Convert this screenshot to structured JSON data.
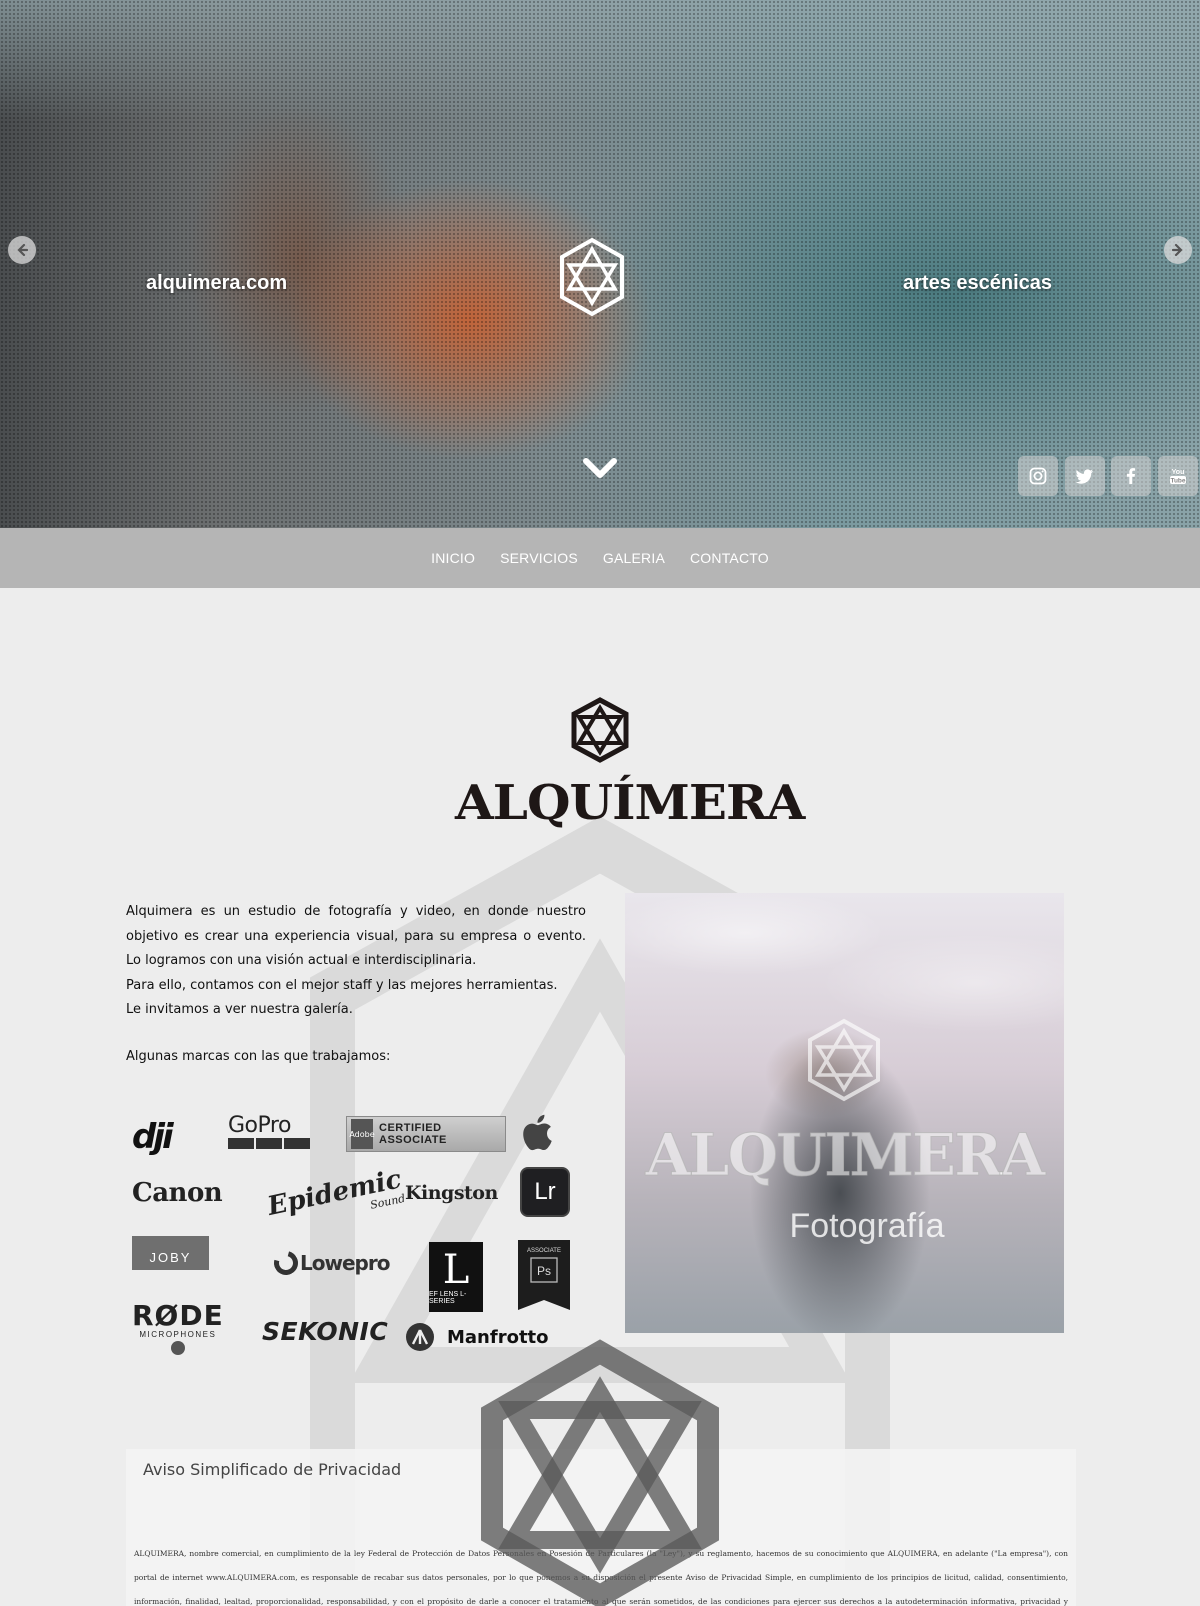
{
  "hero": {
    "left_text": "alquimera.com",
    "right_text": "artes escénicas",
    "prev_icon": "arrow-left-icon",
    "next_icon": "arrow-right-icon",
    "scroll_icon": "chevron-down-icon",
    "social": [
      {
        "name": "instagram",
        "icon": "instagram-icon"
      },
      {
        "name": "twitter",
        "icon": "twitter-icon"
      },
      {
        "name": "facebook",
        "icon": "facebook-icon"
      },
      {
        "name": "youtube",
        "icon": "youtube-icon",
        "label": "You Tube"
      }
    ]
  },
  "nav": {
    "items": [
      {
        "label": "INICIO"
      },
      {
        "label": "SERVICIOS"
      },
      {
        "label": "GALERIA"
      },
      {
        "label": "CONTACTO"
      }
    ]
  },
  "brand": {
    "wordmark": "ALQUÍMERA",
    "logo_icon": "alquimera-emblem-icon"
  },
  "intro": {
    "paragraph1": "Alquimera es un estudio de fotografía y video, en donde nuestro objetivo es crear una experiencia visual, para su empresa o evento. Lo logramos con una visión actual e interdisciplinaria.",
    "paragraph2": "Para ello, contamos con el mejor staff y las mejores herramientas.",
    "paragraph3": "Le invitamos a ver nuestra galería.",
    "brands_title": "Algunas marcas con las que trabajamos:"
  },
  "brands": {
    "dji": "dji",
    "gopro": "GoPro",
    "adobe": "CERTIFIED ASSOCIATE",
    "adobe_small": "Adobe",
    "apple_icon": "apple-icon",
    "canon": "Canon",
    "epidemic": "Epidemic",
    "epidemic_sub": "Sound",
    "kingston": "Kingston",
    "lightroom": "Lr",
    "joby": "JOBY",
    "lowepro": "Lowepro",
    "llens": "L",
    "llens_sub": "EF LENS L-SERIES",
    "photoshop_top": "ASSOCIATE",
    "photoshop": "Ps",
    "rode": "RØDE",
    "rode_sub": "MICROPHONES",
    "sekonic": "SEKONIC",
    "manfrotto": "Manfrotto"
  },
  "photo": {
    "wordmark": "ALQUIMERA",
    "subtitle": "Fotografía"
  },
  "privacy": {
    "title": "Aviso Simplificado de Privacidad",
    "body": "ALQUIMERA, nombre comercial, en cumplimiento de la ley Federal de Protección de Datos Personales en Posesión de Particulares (la \"Ley\"), y su reglamento, hacemos de su conocimiento que ALQUIMERA, en adelante (\"La empresa\"), con portal de internet www.ALQUIMERA.com, es responsable de recabar sus datos personales, por lo que ponemos a su disposición el presente Aviso de Privacidad Simple, en cumplimiento de los principios de licitud, calidad, consentimiento, información, finalidad, lealtad, proporcionalidad, responsabilidad, y con el propósito de darle a conocer el tratamiento al que serán sometidos, de las condiciones para ejercer sus derechos a la autodeterminación informativa, privacidad y protección de los mismos."
  },
  "colors": {
    "nav_bg": "#b5b5b5",
    "page_bg": "#ededed",
    "brand_dark": "#1e1716"
  }
}
